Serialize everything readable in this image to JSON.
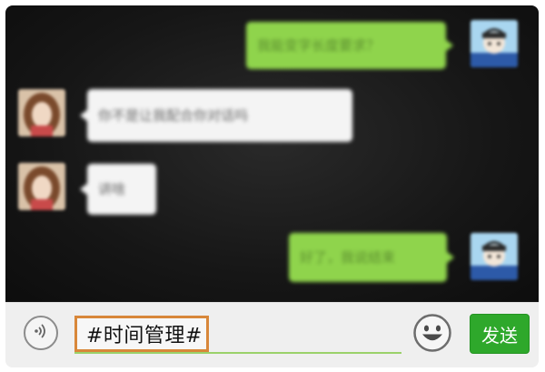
{
  "messages": [
    {
      "side": "right",
      "sender": "me",
      "text": "我能变字长度要求？"
    },
    {
      "side": "left",
      "sender": "friend",
      "text": "你不是让我配合你对话吗"
    },
    {
      "side": "left",
      "sender": "friend",
      "text": "讲啥"
    },
    {
      "side": "right",
      "sender": "me",
      "text": "好了，我说结束"
    }
  ],
  "input": {
    "value": "#时间管理#"
  },
  "buttons": {
    "send_label": "发送"
  },
  "icons": {
    "voice": "voice-icon",
    "emoji": "smiley-icon"
  },
  "colors": {
    "outgoing_bubble": "#8fd44c",
    "incoming_bubble": "#f4f4f4",
    "send_button": "#2ea82b",
    "highlight_border": "#d8873a",
    "input_underline": "#9bd16a"
  }
}
